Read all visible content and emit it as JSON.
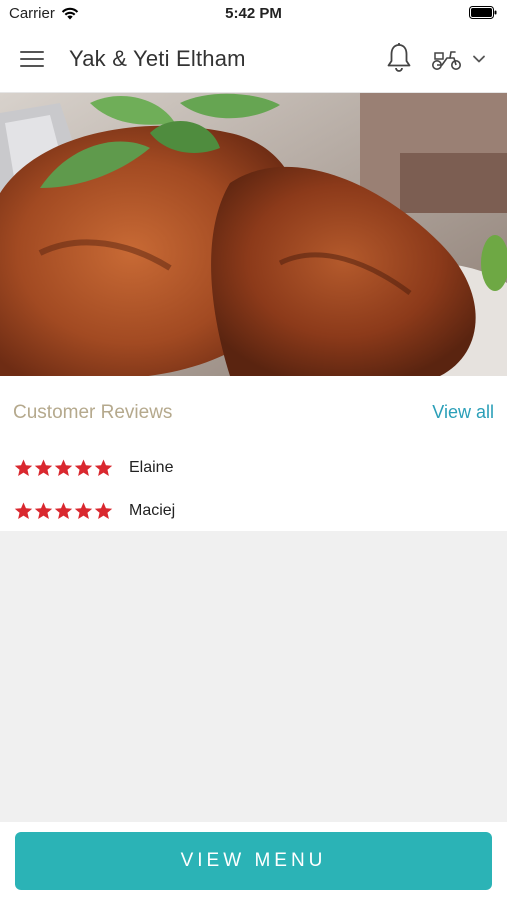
{
  "status_bar": {
    "carrier": "Carrier",
    "time": "5:42 PM"
  },
  "header": {
    "title": "Yak & Yeti  Eltham"
  },
  "hero": {
    "icon": "food-photo"
  },
  "reviews": {
    "title": "Customer Reviews",
    "view_all_label": "View all",
    "star_color": "#d9282f",
    "items": [
      {
        "name": "Elaine",
        "rating": 5
      },
      {
        "name": "Maciej",
        "rating": 5
      }
    ]
  },
  "footer": {
    "view_menu_label": "VIEW MENU"
  },
  "colors": {
    "accent": "#2bb3b6",
    "link": "#2a9fb8",
    "section_title": "#b5a98d"
  }
}
